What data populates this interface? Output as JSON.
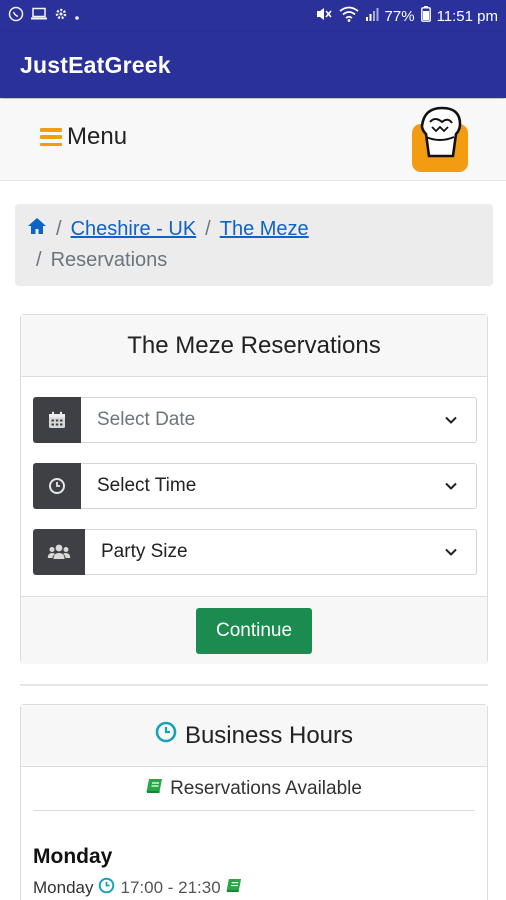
{
  "status_bar": {
    "battery": "77%",
    "time": "11:51 pm"
  },
  "app": {
    "title": "JustEatGreek"
  },
  "nav": {
    "menu_label": "Menu"
  },
  "breadcrumb": {
    "items": [
      {
        "label": "Cheshire - UK"
      },
      {
        "label": "The Meze"
      }
    ],
    "active": "Reservations"
  },
  "reservation": {
    "title": "The Meze Reservations",
    "date_placeholder": "Select Date",
    "time_value": "Select Time",
    "party_value": "Party Size",
    "continue_label": "Continue"
  },
  "hours": {
    "title": "Business Hours",
    "availability": "Reservations Available",
    "day": "Monday",
    "entry_day": "Monday",
    "entry_time": "17:00 - 21:30"
  },
  "colors": {
    "app_bar": "#2a319a",
    "accent_orange": "#f39c12",
    "link": "#0d63c7",
    "button_green": "#1c8b4f",
    "addon_dark": "#3f3f46",
    "clock_cyan": "#17a2b8",
    "book_green": "#28a745"
  }
}
